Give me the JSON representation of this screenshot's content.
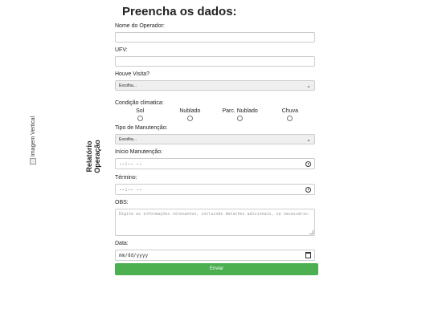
{
  "side_image": {
    "alt_text": "Imagem Vertical"
  },
  "side_title": {
    "line1": "Relatório",
    "line2": "Operação"
  },
  "form": {
    "title": "Preencha os dados:",
    "operator": {
      "label": "Nome do Operador:",
      "value": ""
    },
    "ufv": {
      "label": "UFV:",
      "value": ""
    },
    "visit": {
      "label": "Houve Visita?",
      "selected": "Escolha..."
    },
    "climate": {
      "label": "Condição climatica:",
      "options": [
        "Sol",
        "Nublado",
        "Parc. Nublado",
        "Chuva"
      ]
    },
    "maintenance_type": {
      "label": "Tipo de Manutenção:",
      "selected": "Escolha..."
    },
    "start": {
      "label": "Início Manutenção:",
      "placeholder": "--:-- --"
    },
    "end": {
      "label": "Término:",
      "placeholder": "--:-- --"
    },
    "obs": {
      "label": "OBS:",
      "placeholder": "Digite as informações relevantes, incluindo detalhes adicionais, se necessário."
    },
    "date": {
      "label": "Data:",
      "placeholder": "mm/dd/yyyy"
    },
    "submit_label": "Enviar"
  },
  "icons": {
    "clock": "clock-icon",
    "calendar": "calendar-icon",
    "chevron": "chevron-down-icon"
  },
  "colors": {
    "submit": "#4caf50"
  }
}
